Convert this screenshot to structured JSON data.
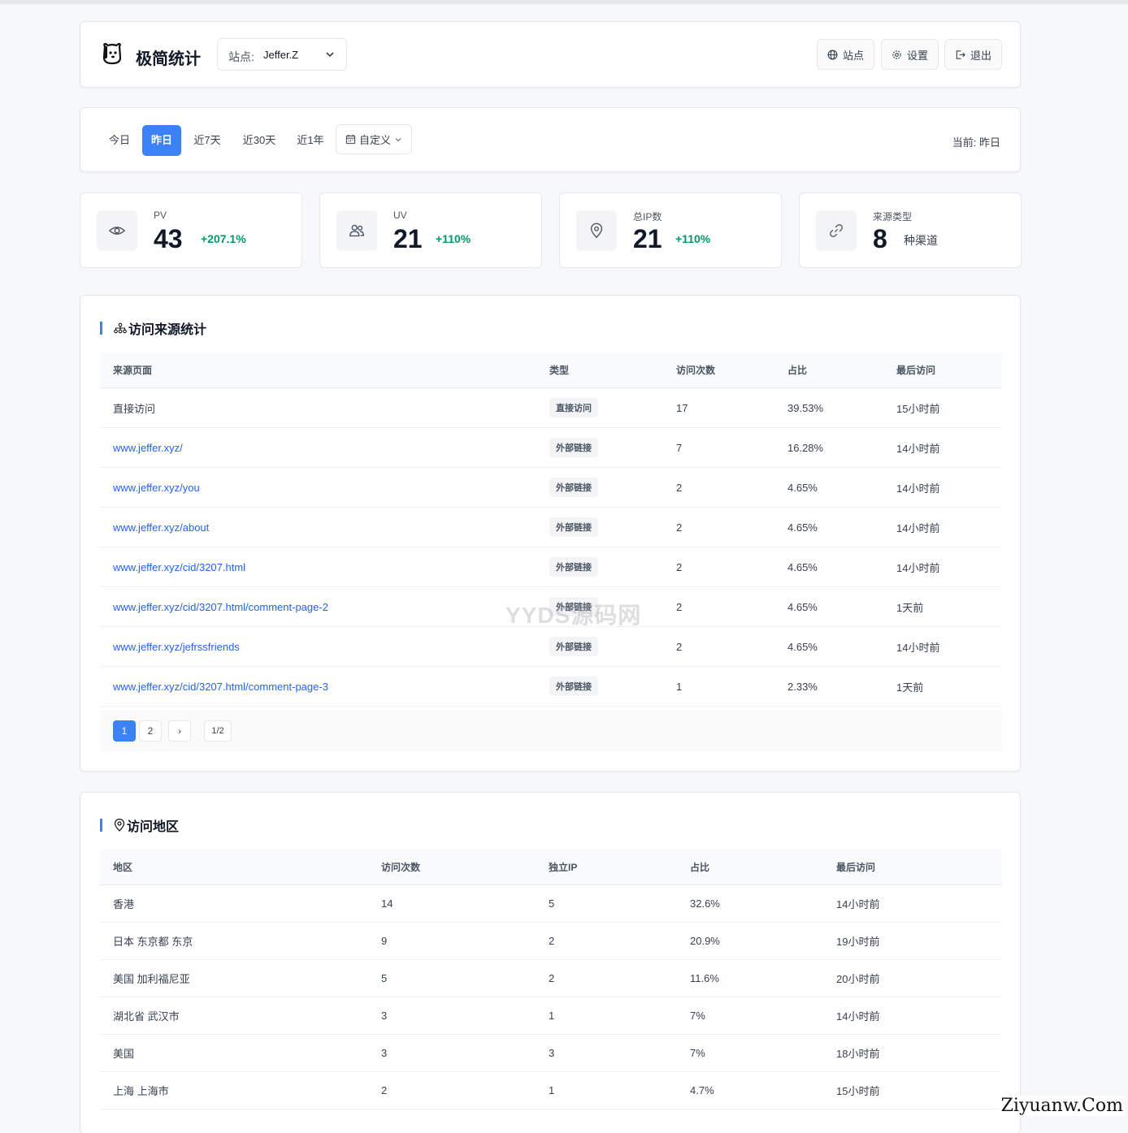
{
  "app": {
    "title": "极简统计"
  },
  "site_select": {
    "label": "站点:",
    "value": "Jeffer.Z"
  },
  "header_buttons": {
    "sites": "站点",
    "settings": "设置",
    "logout": "退出"
  },
  "ranges": [
    "今日",
    "昨日",
    "近7天",
    "近30天",
    "近1年"
  ],
  "active_range": "昨日",
  "custom_label": "自定义",
  "current_label": "当前: 昨日",
  "stats": [
    {
      "label": "PV",
      "value": "43",
      "change": "+207.1%",
      "icon": "eye-icon"
    },
    {
      "label": "UV",
      "value": "21",
      "change": "+110%",
      "icon": "users-icon"
    },
    {
      "label": "总IP数",
      "value": "21",
      "change": "+110%",
      "icon": "map-pin-icon"
    },
    {
      "label": "来源类型",
      "value": "8",
      "change": "种渠道",
      "icon": "link-icon"
    }
  ],
  "sources": {
    "title": "访问来源统计",
    "columns": [
      "来源页面",
      "类型",
      "访问次数",
      "占比",
      "最后访问"
    ],
    "rows": [
      {
        "page": "直接访问",
        "type": "直接访问",
        "visits": "17",
        "ratio": "39.53%",
        "last": "15小时前"
      },
      {
        "page": "www.jeffer.xyz/",
        "type": "外部链接",
        "visits": "7",
        "ratio": "16.28%",
        "last": "14小时前"
      },
      {
        "page": "www.jeffer.xyz/you",
        "type": "外部链接",
        "visits": "2",
        "ratio": "4.65%",
        "last": "14小时前"
      },
      {
        "page": "www.jeffer.xyz/about",
        "type": "外部链接",
        "visits": "2",
        "ratio": "4.65%",
        "last": "14小时前"
      },
      {
        "page": "www.jeffer.xyz/cid/3207.html",
        "type": "外部链接",
        "visits": "2",
        "ratio": "4.65%",
        "last": "14小时前"
      },
      {
        "page": "www.jeffer.xyz/cid/3207.html/comment-page-2",
        "type": "外部链接",
        "visits": "2",
        "ratio": "4.65%",
        "last": "1天前"
      },
      {
        "page": "www.jeffer.xyz/jefrssfriends",
        "type": "外部链接",
        "visits": "2",
        "ratio": "4.65%",
        "last": "14小时前"
      },
      {
        "page": "www.jeffer.xyz/cid/3207.html/comment-page-3",
        "type": "外部链接",
        "visits": "1",
        "ratio": "2.33%",
        "last": "1天前"
      }
    ],
    "pagination": {
      "pages": [
        "1",
        "2"
      ],
      "next": "›",
      "info": "1/2",
      "active": "1"
    }
  },
  "regions": {
    "title": "访问地区",
    "columns": [
      "地区",
      "访问次数",
      "独立IP",
      "占比",
      "最后访问"
    ],
    "rows": [
      {
        "region": "香港",
        "visits": "14",
        "ips": "5",
        "ratio": "32.6%",
        "last": "14小时前"
      },
      {
        "region": "日本 东京都 东京",
        "visits": "9",
        "ips": "2",
        "ratio": "20.9%",
        "last": "19小时前"
      },
      {
        "region": "美国 加利福尼亚",
        "visits": "5",
        "ips": "2",
        "ratio": "11.6%",
        "last": "20小时前"
      },
      {
        "region": "湖北省 武汉市",
        "visits": "3",
        "ips": "1",
        "ratio": "7%",
        "last": "14小时前"
      },
      {
        "region": "美国",
        "visits": "3",
        "ips": "3",
        "ratio": "7%",
        "last": "18小时前"
      },
      {
        "region": "上海 上海市",
        "visits": "2",
        "ips": "1",
        "ratio": "4.7%",
        "last": "15小时前"
      }
    ]
  },
  "watermarks": {
    "center": "YYDS源码网",
    "corner": "Ziyuanw.Com"
  },
  "colors": {
    "accent": "#3b82f6",
    "positive": "#059669",
    "link": "#2563eb"
  }
}
